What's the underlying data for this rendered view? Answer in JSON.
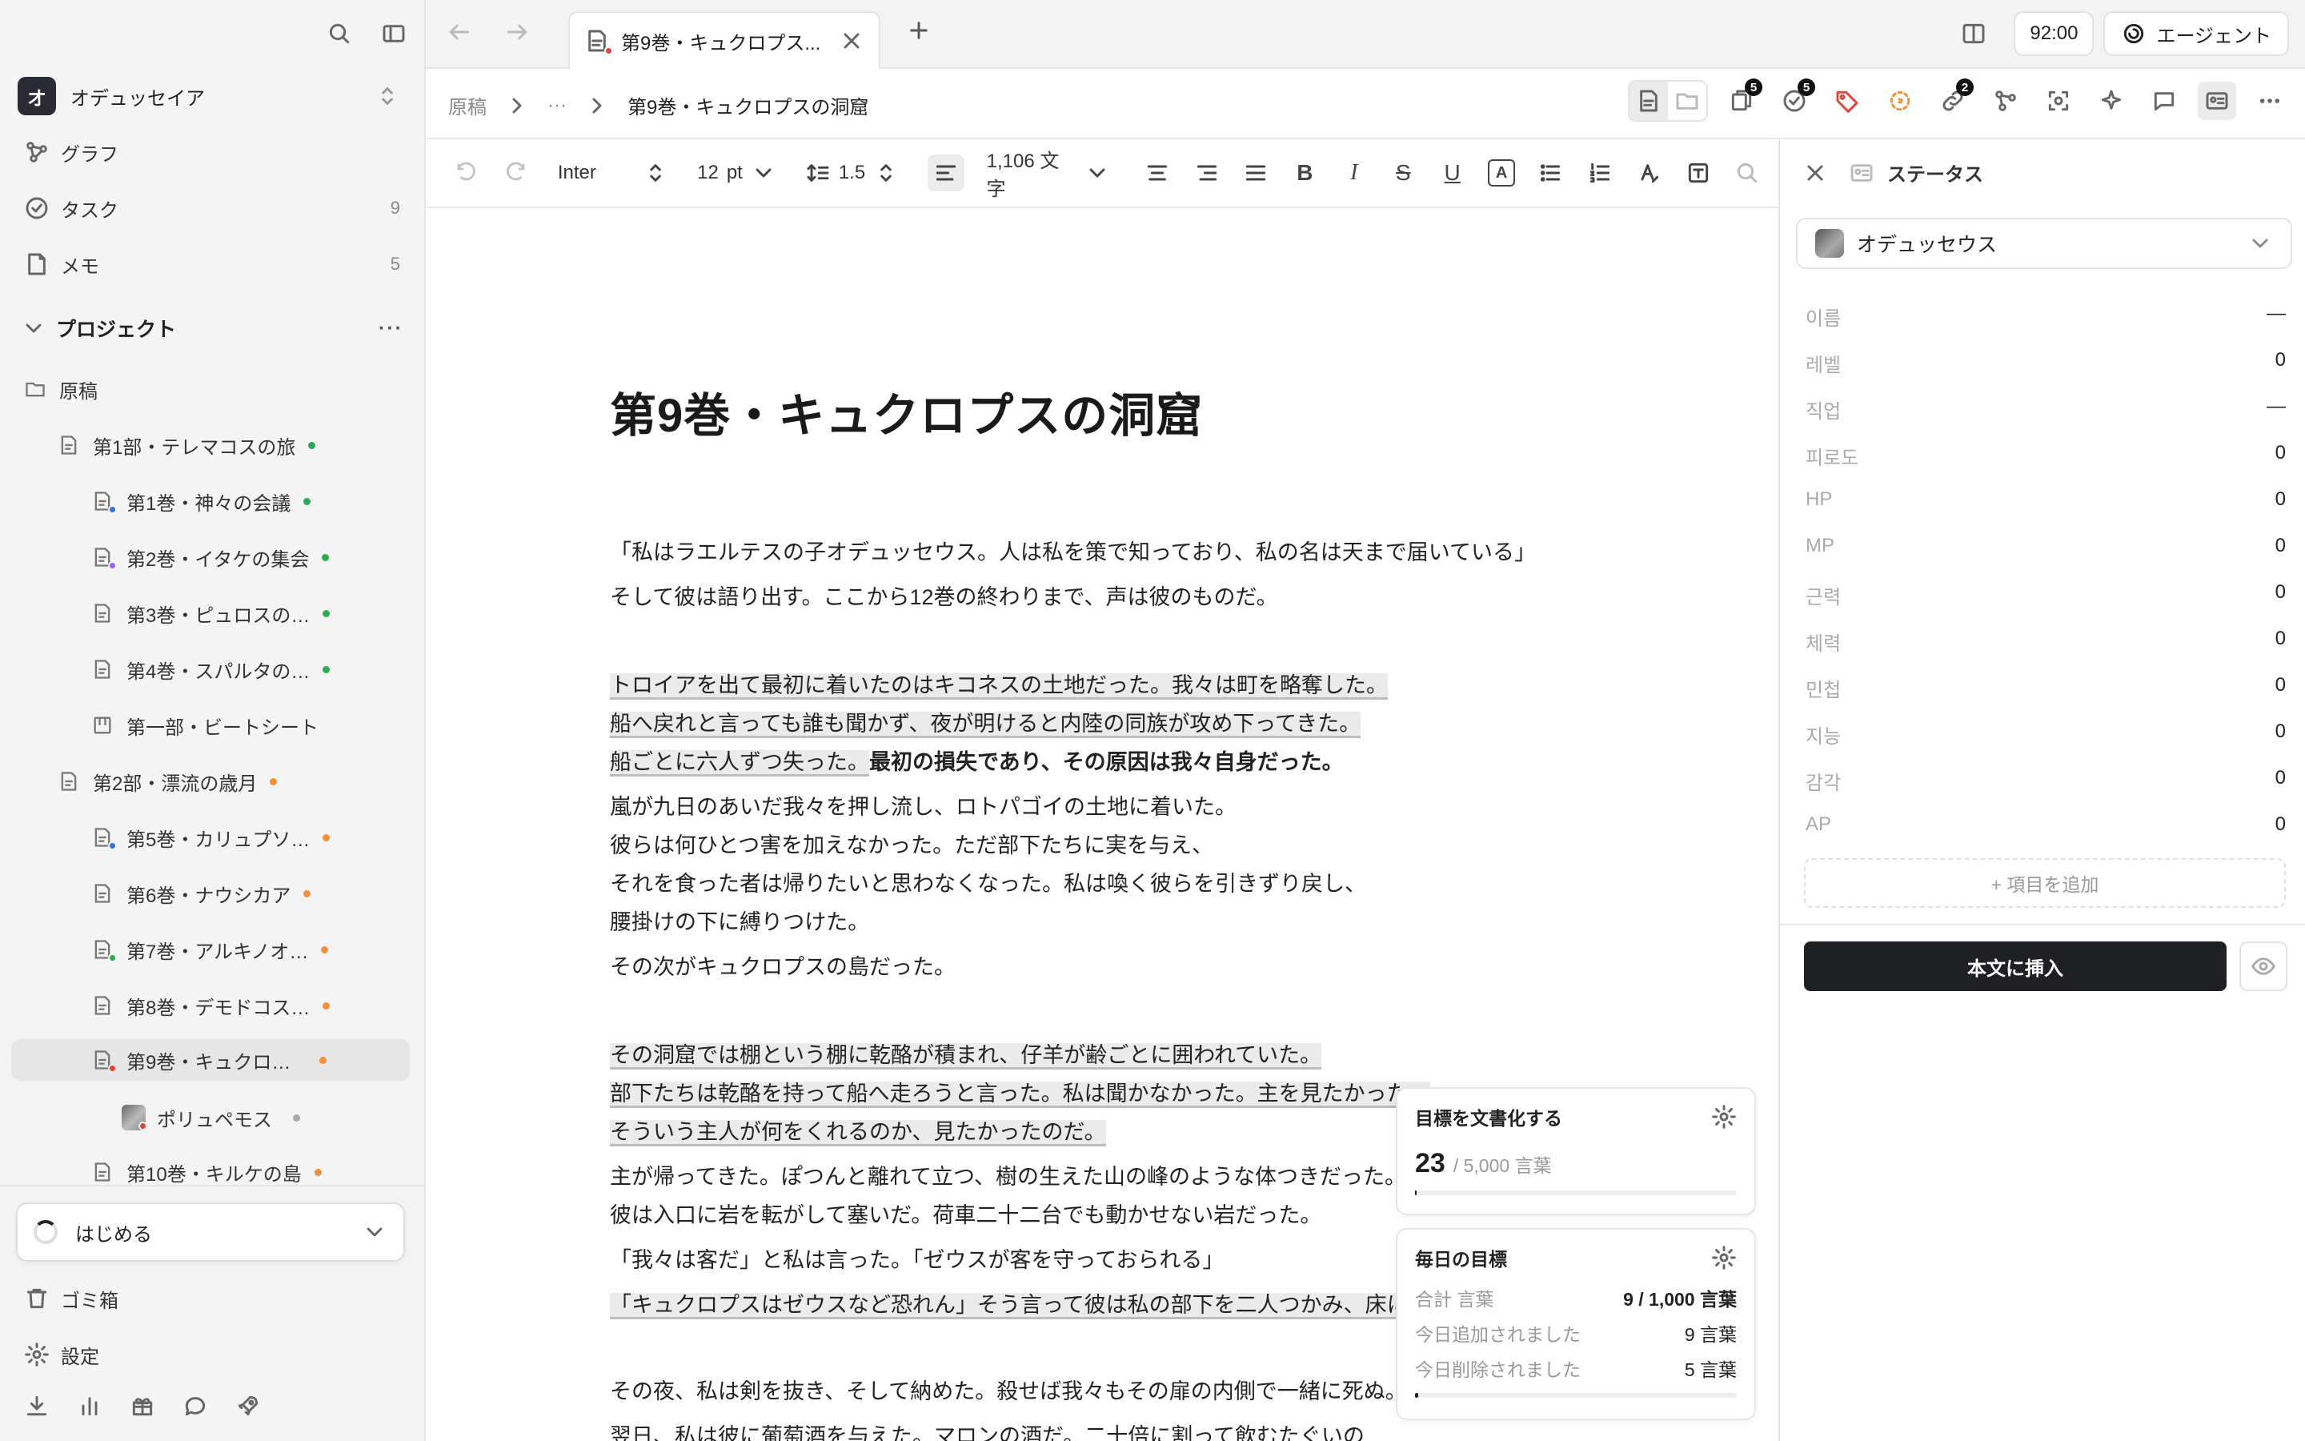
{
  "sidebar": {
    "workspace": {
      "initial": "オ",
      "name": "オデュッセイア"
    },
    "nav": [
      {
        "label": "グラフ",
        "count": ""
      },
      {
        "label": "タスク",
        "count": "9"
      },
      {
        "label": "メモ",
        "count": "5"
      }
    ],
    "project_label": "プロジェクト",
    "tree": [
      {
        "label": "原稿",
        "dot": ""
      },
      {
        "label": "第1部・テレマコスの旅",
        "dot": "#2eaa55"
      },
      {
        "label": "第1巻・神々の会議",
        "dot": "#2eaa55",
        "sub": "#3b6fd8"
      },
      {
        "label": "第2巻・イタケの集会",
        "dot": "#2eaa55",
        "sub": "#9a66e0"
      },
      {
        "label": "第3巻・ピュロスの…",
        "dot": "#2eaa55"
      },
      {
        "label": "第4巻・スパルタの…",
        "dot": "#2eaa55"
      },
      {
        "label": "第一部・ビートシート",
        "dot": ""
      },
      {
        "label": "第2部・漂流の歳月",
        "dot": "#f0903a"
      },
      {
        "label": "第5巻・カリュプソ…",
        "dot": "#f0903a",
        "sub": "#3b6fd8"
      },
      {
        "label": "第6巻・ナウシカア",
        "dot": "#f0903a"
      },
      {
        "label": "第7巻・アルキノオ…",
        "dot": "#f0903a",
        "sub": "#2eaa55"
      },
      {
        "label": "第8巻・デモドコス…",
        "dot": "#f0903a"
      },
      {
        "label": "第9巻・キュクロ…",
        "dot": "#f0903a",
        "sub": "#e0453a"
      },
      {
        "label": "ポリュペモス",
        "dot": "#aaaaaa"
      },
      {
        "label": "第10巻・キルケの島",
        "dot": "#f0903a"
      }
    ],
    "get_started": "はじめる",
    "trash": "ゴミ箱",
    "settings": "設定"
  },
  "tabbar": {
    "tab_title": "第9巻・キュクロプス...",
    "time": "92:00",
    "agent": "エージェント"
  },
  "breadcrumb": {
    "root": "原稿",
    "ellipsis": "···",
    "current": "第9巻・キュクロプスの洞窟"
  },
  "badges": {
    "notes": "5",
    "tasks": "5",
    "links": "2"
  },
  "format": {
    "font": "Inter",
    "size": "12",
    "unit": "pt",
    "spacing": "1.5",
    "word_count": "1,106 文字"
  },
  "document": {
    "title": "第9巻・キュクロプスの洞窟",
    "paragraphs": [
      "「私はラエルテスの子オデュッセウス。人は私を策で知っており、私の名は天まで届いている」",
      "そして彼は語り出す。ここから12巻の終わりまで、声は彼のものだ。",
      "トロイアを出て最初に着いたのはキコネスの土地だった。我々は町を略奪した。",
      "船へ戻れと言っても誰も聞かず、夜が明けると内陸の同族が攻め下ってきた。",
      "船ごとに六人ずつ失った。",
      "最初の損失であり、その原因は我々自身だった。",
      "嵐が九日のあいだ我々を押し流し、ロトパゴイの土地に着いた。",
      "彼らは何ひとつ害を加えなかった。ただ部下たちに実を与え、",
      "それを食った者は帰りたいと思わなくなった。私は喚く彼らを引きずり戻し、",
      "腰掛けの下に縛りつけた。",
      "その次がキュクロプスの島だった。",
      "その洞窟では棚という棚に乾酪が積まれ、仔羊が齢ごとに囲われていた。",
      "部下たちは乾酪を持って船へ走ろうと言った。私は聞かなかった。主を見たかった。",
      "そういう主人が何をくれるのか、見たかったのだ。",
      "主が帰ってきた。ぽつんと離れて立つ、樹の生えた山の峰のような体つきだった。",
      "彼は入口に岩を転がして塞いだ。荷車二十二台でも動かせない岩だった。",
      "「我々は客だ」と私は言った。「ゼウスが客を守っておられる」",
      "「キュクロプスはゼウスなど恐れん」そう言って彼は私の部下を二人つかみ、床に叩きつけた。",
      "その夜、私は剣を抜き、そして納めた。殺せば我々もその扉の内側で一緒に死ぬ。",
      "翌日、私は彼に葡萄酒を与えた。マロンの酒だ。二十倍に割って飲むたぐいの"
    ]
  },
  "goals": {
    "doc_goal": {
      "title": "目標を文書化する",
      "current": "23",
      "target": "/ 5,000 言葉",
      "progress": 0.005
    },
    "daily": {
      "title": "毎日の目標",
      "rows": [
        {
          "k": "合計 言葉",
          "v": "9 / 1,000 言葉"
        },
        {
          "k": "今日追加されました",
          "v": "9 言葉"
        },
        {
          "k": "今日削除されました",
          "v": "5 言葉"
        }
      ],
      "progress": 0.009
    }
  },
  "status_panel": {
    "title": "ステータス",
    "character": "オデュッセウス",
    "stats": [
      {
        "k": "이름",
        "v": "—"
      },
      {
        "k": "레벨",
        "v": "0"
      },
      {
        "k": "직업",
        "v": "—"
      },
      {
        "k": "피로도",
        "v": "0"
      },
      {
        "k": "HP",
        "v": "0"
      },
      {
        "k": "MP",
        "v": "0"
      },
      {
        "k": "근력",
        "v": "0"
      },
      {
        "k": "체력",
        "v": "0"
      },
      {
        "k": "민첩",
        "v": "0"
      },
      {
        "k": "지능",
        "v": "0"
      },
      {
        "k": "감각",
        "v": "0"
      },
      {
        "k": "AP",
        "v": "0"
      }
    ],
    "add_item": "+ 項目を追加",
    "insert": "本文に挿入"
  }
}
